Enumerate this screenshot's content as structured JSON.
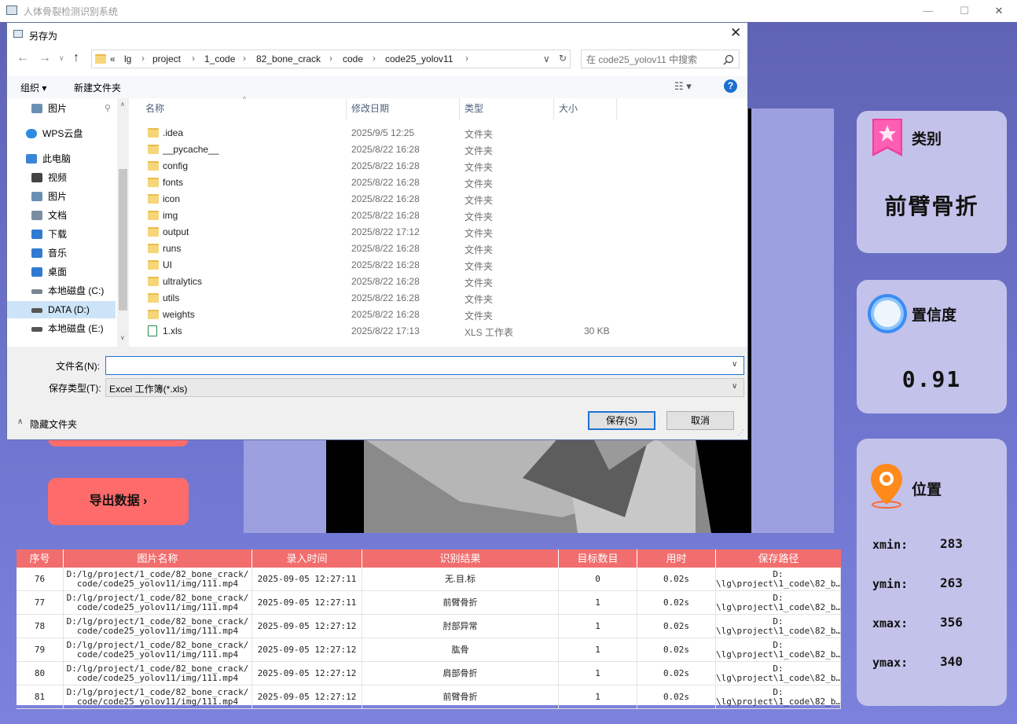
{
  "app": {
    "title": "人体骨裂检测识别系统",
    "min_icon": "—",
    "max_icon": "☐",
    "close_icon": "✕"
  },
  "cards": {
    "category": {
      "title": "类别",
      "value": "前臂骨折"
    },
    "confidence": {
      "title": "置信度",
      "value": "0.91"
    },
    "position": {
      "title": "位置",
      "xmin_label": "xmin:",
      "xmin": "283",
      "ymin_label": "ymin:",
      "ymin": "263",
      "xmax_label": "xmax:",
      "xmax": "356",
      "ymax_label": "ymax:",
      "ymax": "340"
    }
  },
  "buttons": {
    "export": "导出数据 ›"
  },
  "table": {
    "headers": [
      "序号",
      "图片名称",
      "录入时间",
      "识别结果",
      "目标数目",
      "用时",
      "保存路径"
    ],
    "rows": [
      {
        "id": "76",
        "name1": "D:/lg/project/1_code/82_bone_crack/",
        "name2": "code/code25_yolov11/img/111.mp4",
        "time": "2025-09-05 12:27:11",
        "result": "无.目.标",
        "count": "0",
        "dur": "0.02s",
        "path1": "D:",
        "path2": "\\lg\\project\\1_code\\82_b…"
      },
      {
        "id": "77",
        "name1": "D:/lg/project/1_code/82_bone_crack/",
        "name2": "code/code25_yolov11/img/111.mp4",
        "time": "2025-09-05 12:27:11",
        "result": "前臂骨折",
        "count": "1",
        "dur": "0.02s",
        "path1": "D:",
        "path2": "\\lg\\project\\1_code\\82_b…"
      },
      {
        "id": "78",
        "name1": "D:/lg/project/1_code/82_bone_crack/",
        "name2": "code/code25_yolov11/img/111.mp4",
        "time": "2025-09-05 12:27:12",
        "result": "肘部异常",
        "count": "1",
        "dur": "0.02s",
        "path1": "D:",
        "path2": "\\lg\\project\\1_code\\82_b…"
      },
      {
        "id": "79",
        "name1": "D:/lg/project/1_code/82_bone_crack/",
        "name2": "code/code25_yolov11/img/111.mp4",
        "time": "2025-09-05 12:27:12",
        "result": "肱骨",
        "count": "1",
        "dur": "0.02s",
        "path1": "D:",
        "path2": "\\lg\\project\\1_code\\82_b…"
      },
      {
        "id": "80",
        "name1": "D:/lg/project/1_code/82_bone_crack/",
        "name2": "code/code25_yolov11/img/111.mp4",
        "time": "2025-09-05 12:27:12",
        "result": "肩部骨折",
        "count": "1",
        "dur": "0.02s",
        "path1": "D:",
        "path2": "\\lg\\project\\1_code\\82_b…"
      },
      {
        "id": "81",
        "name1": "D:/lg/project/1_code/82_bone_crack/",
        "name2": "code/code25_yolov11/img/111.mp4",
        "time": "2025-09-05 12:27:12",
        "result": "前臂骨折",
        "count": "1",
        "dur": "0.02s",
        "path1": "D:",
        "path2": "\\lg\\project\\1_code\\82_b…"
      }
    ]
  },
  "dialog": {
    "title": "另存为",
    "address": [
      "lg",
      "project",
      "1_code",
      "82_bone_crack",
      "code",
      "code25_yolov11"
    ],
    "address_prefix": "«",
    "search_placeholder": "在 code25_yolov11 中搜索",
    "toolbar": {
      "organize": "组织 ▾",
      "new_folder": "新建文件夹",
      "help": "?"
    },
    "nav": [
      {
        "label": "图片",
        "icon": "pictures-icon",
        "color": "#6b8fb3"
      },
      {
        "label": "WPS云盘",
        "icon": "cloud-icon",
        "color": "#2f8be0"
      },
      {
        "label": "此电脑",
        "icon": "computer-icon",
        "color": "#3a86d6"
      },
      {
        "label": "视频",
        "icon": "video-icon",
        "color": "#444"
      },
      {
        "label": "图片",
        "icon": "pictures-icon",
        "color": "#6b8fb3"
      },
      {
        "label": "文档",
        "icon": "document-icon",
        "color": "#7a8da3"
      },
      {
        "label": "下载",
        "icon": "download-icon",
        "color": "#2f7bd1"
      },
      {
        "label": "音乐",
        "icon": "music-icon",
        "color": "#2f7bd1"
      },
      {
        "label": "桌面",
        "icon": "desktop-icon",
        "color": "#2f7bd1"
      },
      {
        "label": "本地磁盘 (C:)",
        "icon": "disk-icon",
        "color": "#7a8590"
      },
      {
        "label": "DATA (D:)",
        "icon": "disk-icon",
        "color": "#555"
      },
      {
        "label": "本地磁盘 (E:)",
        "icon": "disk-icon",
        "color": "#555"
      }
    ],
    "columns": {
      "name": "名称",
      "date": "修改日期",
      "type": "类型",
      "size": "大小"
    },
    "files": [
      {
        "name": ".idea",
        "date": "2025/9/5 12:25",
        "type": "文件夹",
        "size": ""
      },
      {
        "name": "__pycache__",
        "date": "2025/8/22 16:28",
        "type": "文件夹",
        "size": ""
      },
      {
        "name": "config",
        "date": "2025/8/22 16:28",
        "type": "文件夹",
        "size": ""
      },
      {
        "name": "fonts",
        "date": "2025/8/22 16:28",
        "type": "文件夹",
        "size": ""
      },
      {
        "name": "icon",
        "date": "2025/8/22 16:28",
        "type": "文件夹",
        "size": ""
      },
      {
        "name": "img",
        "date": "2025/8/22 16:28",
        "type": "文件夹",
        "size": ""
      },
      {
        "name": "output",
        "date": "2025/8/22 17:12",
        "type": "文件夹",
        "size": ""
      },
      {
        "name": "runs",
        "date": "2025/8/22 16:28",
        "type": "文件夹",
        "size": ""
      },
      {
        "name": "UI",
        "date": "2025/8/22 16:28",
        "type": "文件夹",
        "size": ""
      },
      {
        "name": "ultralytics",
        "date": "2025/8/22 16:28",
        "type": "文件夹",
        "size": ""
      },
      {
        "name": "utils",
        "date": "2025/8/22 16:28",
        "type": "文件夹",
        "size": ""
      },
      {
        "name": "weights",
        "date": "2025/8/22 16:28",
        "type": "文件夹",
        "size": ""
      },
      {
        "name": "1.xls",
        "date": "2025/8/22 17:13",
        "type": "XLS 工作表",
        "size": "30 KB"
      }
    ],
    "filename_label": "文件名(N):",
    "filename_value": "",
    "filetype_label": "保存类型(T):",
    "filetype_value": "Excel 工作簿(*.xls)",
    "hide_folders": "隐藏文件夹",
    "save": "保存(S)",
    "cancel": "取消"
  }
}
